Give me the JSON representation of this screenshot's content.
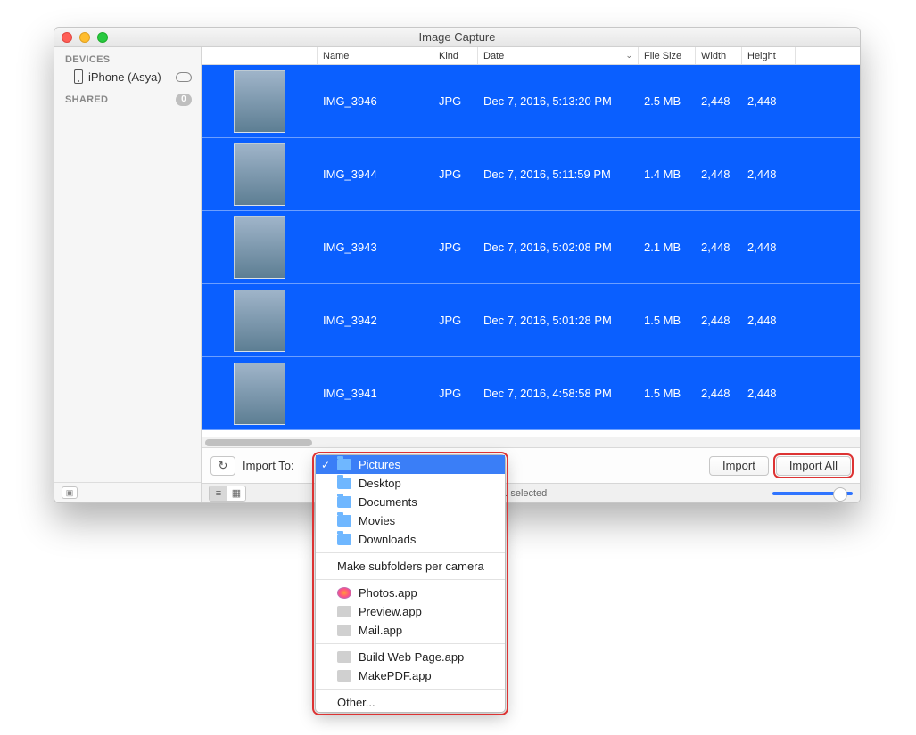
{
  "window": {
    "title": "Image Capture"
  },
  "sidebar": {
    "devices_header": "DEVICES",
    "device_name": "iPhone (Asya)",
    "shared_header": "SHARED",
    "shared_count": "0"
  },
  "columns": {
    "name": "Name",
    "kind": "Kind",
    "date": "Date",
    "file_size": "File Size",
    "width": "Width",
    "height": "Height"
  },
  "rows": [
    {
      "name": "IMG_3946",
      "kind": "JPG",
      "date": "Dec 7, 2016, 5:13:20 PM",
      "size": "2.5 MB",
      "width": "2,448",
      "height": "2,448"
    },
    {
      "name": "IMG_3944",
      "kind": "JPG",
      "date": "Dec 7, 2016, 5:11:59 PM",
      "size": "1.4 MB",
      "width": "2,448",
      "height": "2,448"
    },
    {
      "name": "IMG_3943",
      "kind": "JPG",
      "date": "Dec 7, 2016, 5:02:08 PM",
      "size": "2.1 MB",
      "width": "2,448",
      "height": "2,448"
    },
    {
      "name": "IMG_3942",
      "kind": "JPG",
      "date": "Dec 7, 2016, 5:01:28 PM",
      "size": "1.5 MB",
      "width": "2,448",
      "height": "2,448"
    },
    {
      "name": "IMG_3941",
      "kind": "JPG",
      "date": "Dec 7, 2016, 4:58:58 PM",
      "size": "1.5 MB",
      "width": "2,448",
      "height": "2,448"
    }
  ],
  "toolbar": {
    "import_to_label": "Import To:",
    "import_label": "Import",
    "import_all_label": "Import All"
  },
  "status": {
    "text": "of 361 selected"
  },
  "dropdown": {
    "pictures": "Pictures",
    "desktop": "Desktop",
    "documents": "Documents",
    "movies": "Movies",
    "downloads": "Downloads",
    "subfolders": "Make subfolders per camera",
    "photos_app": "Photos.app",
    "preview_app": "Preview.app",
    "mail_app": "Mail.app",
    "build_web": "Build Web Page.app",
    "make_pdf": "MakePDF.app",
    "other": "Other..."
  }
}
